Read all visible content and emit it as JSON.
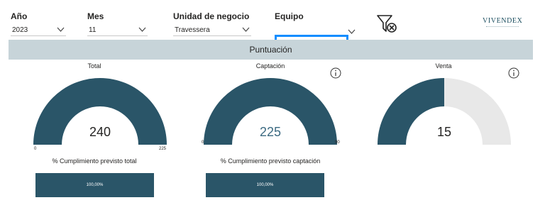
{
  "slicers": {
    "anio": {
      "title": "Año",
      "value": "2023"
    },
    "mes": {
      "title": "Mes",
      "value": "11"
    },
    "unidad": {
      "title": "Unidad de negocio",
      "value": "Travessera"
    },
    "equipo": {
      "title": "Equipo",
      "value": ""
    }
  },
  "toolbar": {
    "clear_filters_icon": "filter-clear-icon"
  },
  "logo": {
    "text": "VIVENDEX"
  },
  "banner": {
    "title": "Puntuación"
  },
  "gauges": [
    {
      "title": "Total",
      "value": "240",
      "min": "0",
      "max": "225",
      "fraction": 1.0,
      "color": "#2a5568",
      "value_color": "#252423"
    },
    {
      "title": "Captación",
      "value": "225",
      "min": "0",
      "max": "90",
      "fraction": 1.0,
      "color": "#2a5568",
      "value_color": "#3d6b82"
    },
    {
      "title": "Venta",
      "value": "15",
      "fraction": 0.5,
      "color": "#2a5568",
      "value_color": "#252423"
    }
  ],
  "kpis": [
    {
      "title": "% Cumplimiento previsto total",
      "value": "100,00%"
    },
    {
      "title": "% Cumplimiento previsto captación",
      "value": "100,00%"
    }
  ],
  "colors": {
    "gauge_fill": "#2a5568",
    "gauge_track": "#e8e8e8",
    "banner": "#c7d4d9",
    "selection_border": "#118dff"
  }
}
